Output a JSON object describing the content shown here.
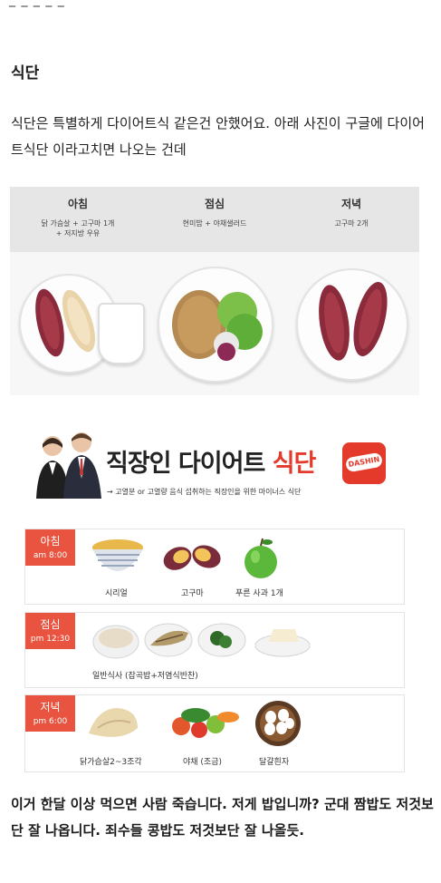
{
  "cut_off_text": "_ _ _ _ _",
  "section_title": "식단",
  "intro_text": "식단은 특별하게 다이어트식 같은건 안했어요. 아래 사진이 구글에 다이어트식단 이라고치면 나오는 건데",
  "meal_photo": {
    "meals": [
      {
        "name": "아침",
        "desc_line1": "닭 가슴살 + 고구마 1개",
        "desc_line2": "+ 저지방 우유"
      },
      {
        "name": "점심",
        "desc_line1": "현미밥 + 야채샐러드",
        "desc_line2": ""
      },
      {
        "name": "저녁",
        "desc_line1": "고구마 2개",
        "desc_line2": ""
      }
    ]
  },
  "office_diet": {
    "title_main": "직장인 다이어트 ",
    "title_accent": "식단",
    "subtitle": "→ 고열분 or 고열량 음식 섭취하는 직장인을 위한 마이너스 식단",
    "logo_text": "DASHIN",
    "breakfast": {
      "label": "아침",
      "time": "am 8:00",
      "items": [
        "시리얼",
        "고구마",
        "푸른 사과 1개"
      ]
    },
    "lunch": {
      "label": "점심",
      "time": "pm 12:30",
      "caption": "일반식사 (잡곡밥+저염식반찬)"
    },
    "dinner": {
      "label": "저녁",
      "time": "pm 6:00",
      "items": [
        "닭가슴살2~3조각",
        "야채 (조금)",
        "달걀흰자"
      ]
    }
  },
  "closing_text": "이거 한달 이상 먹으면 사람 죽습니다. 저게 밥입니까? 군대 짬밥도 저것보단 잘 나옵니다. 죄수들 콩밥도 저것보단 잘 나올듯.",
  "colors": {
    "accent_red": "#e43a2b",
    "time_tab": "#e8543f",
    "sweet_potato": "#8a2a3a",
    "apple": "#5cb83a"
  }
}
